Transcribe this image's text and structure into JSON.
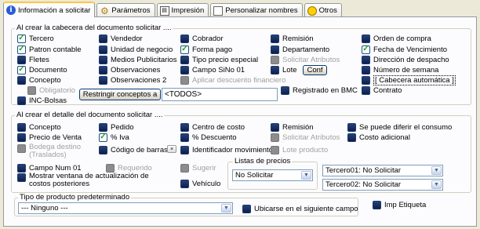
{
  "tabs": [
    {
      "label": "Información a solicitar",
      "icon": "info-icon",
      "active": true
    },
    {
      "label": "Parámetros",
      "icon": "gear-icon"
    },
    {
      "label": "Impresión",
      "icon": "print-icon"
    },
    {
      "label": "Personalizar nombres",
      "icon": "document-icon"
    },
    {
      "label": "Otros",
      "icon": "other-icon"
    }
  ],
  "header_group": {
    "title": "Al crear la cabecera del documento solicitar ....",
    "items": {
      "tercero": "Tercero",
      "patron_contable": "Patron contable",
      "fletes": "Fletes",
      "documento": "Documento",
      "concepto": "Concepto",
      "vendedor": "Vendedor",
      "unidad_negocio": "Unidad de negocio",
      "medios_publicitarios": "Medios Publicitarios",
      "observaciones": "Observaciones",
      "observaciones_2": "Observaciones 2",
      "cobrador": "Cobrador",
      "forma_pago": "Forma pago",
      "tipo_precio_especial": "Tipo precio especial",
      "campo_sino_01": "Campo SiNo 01",
      "aplicar_descuento": "Aplicar descuento financiero",
      "remision": "Remisión",
      "departamento": "Departamento",
      "solicitar_atributos": "Solicitar Atributos",
      "lote": "Lote",
      "orden_compra": "Orden de compra",
      "fecha_vencimiento": "Fecha de Vencimiento",
      "direccion_despacho": "Dirección de despacho",
      "numero_semana": "Número de semana",
      "cabecera_automatica": "[ Cabecera automática ]",
      "contrato": "Contrato",
      "obligatorio": "Obligatorio",
      "inc_bolsas": "INC-Bolsas",
      "registrado_bmc": "Registrado en BMC"
    },
    "lote_conf_button": "Conf",
    "restringir_button": "Restringir conceptos a",
    "restringir_value": "<TODOS>"
  },
  "detail_group": {
    "title": "Al crear  el detalle del documento solicitar ....",
    "items": {
      "concepto": "Concepto",
      "precio_venta": "Precio de Venta",
      "bodega_destino": "Bodega destino",
      "bodega_destino_sub": "(Traslados)",
      "campo_num_01": "Campo Num 01",
      "mostrar_ventana_1": "Mostrar ventana de actualización de",
      "mostrar_ventana_2": "costos posteriores",
      "pedido": "Pedido",
      "iva": "% Iva",
      "codigo_barras": "Código de barras",
      "requerido": "Requerido",
      "centro_costo": "Centro de costo",
      "descuento": "% Descuento",
      "identificador_movimiento": "Identificador movimiento",
      "sugerir": "Sugerir",
      "vehiculo": "Vehículo",
      "remision": "Remisión",
      "solicitar_atributos": "Solicitar Atributos",
      "lote_producto": "Lote producto",
      "puede_diferir": "Se puede diferir el consumo",
      "costo_adicional": "Costo adicional"
    },
    "listas_precios": {
      "label": "Listas de precios",
      "value": "No Solicitar"
    },
    "tercero01": "Tercero01: No Solicitar",
    "tercero02": "Tercero02: No Solicitar"
  },
  "product_type_group": {
    "title": "Tipo de producto predeterminado",
    "value": "--- Ninguno ---",
    "ubicarse": "Ubicarse en el siguiente campo"
  },
  "imp_etiqueta": "Imp Etiqueta"
}
